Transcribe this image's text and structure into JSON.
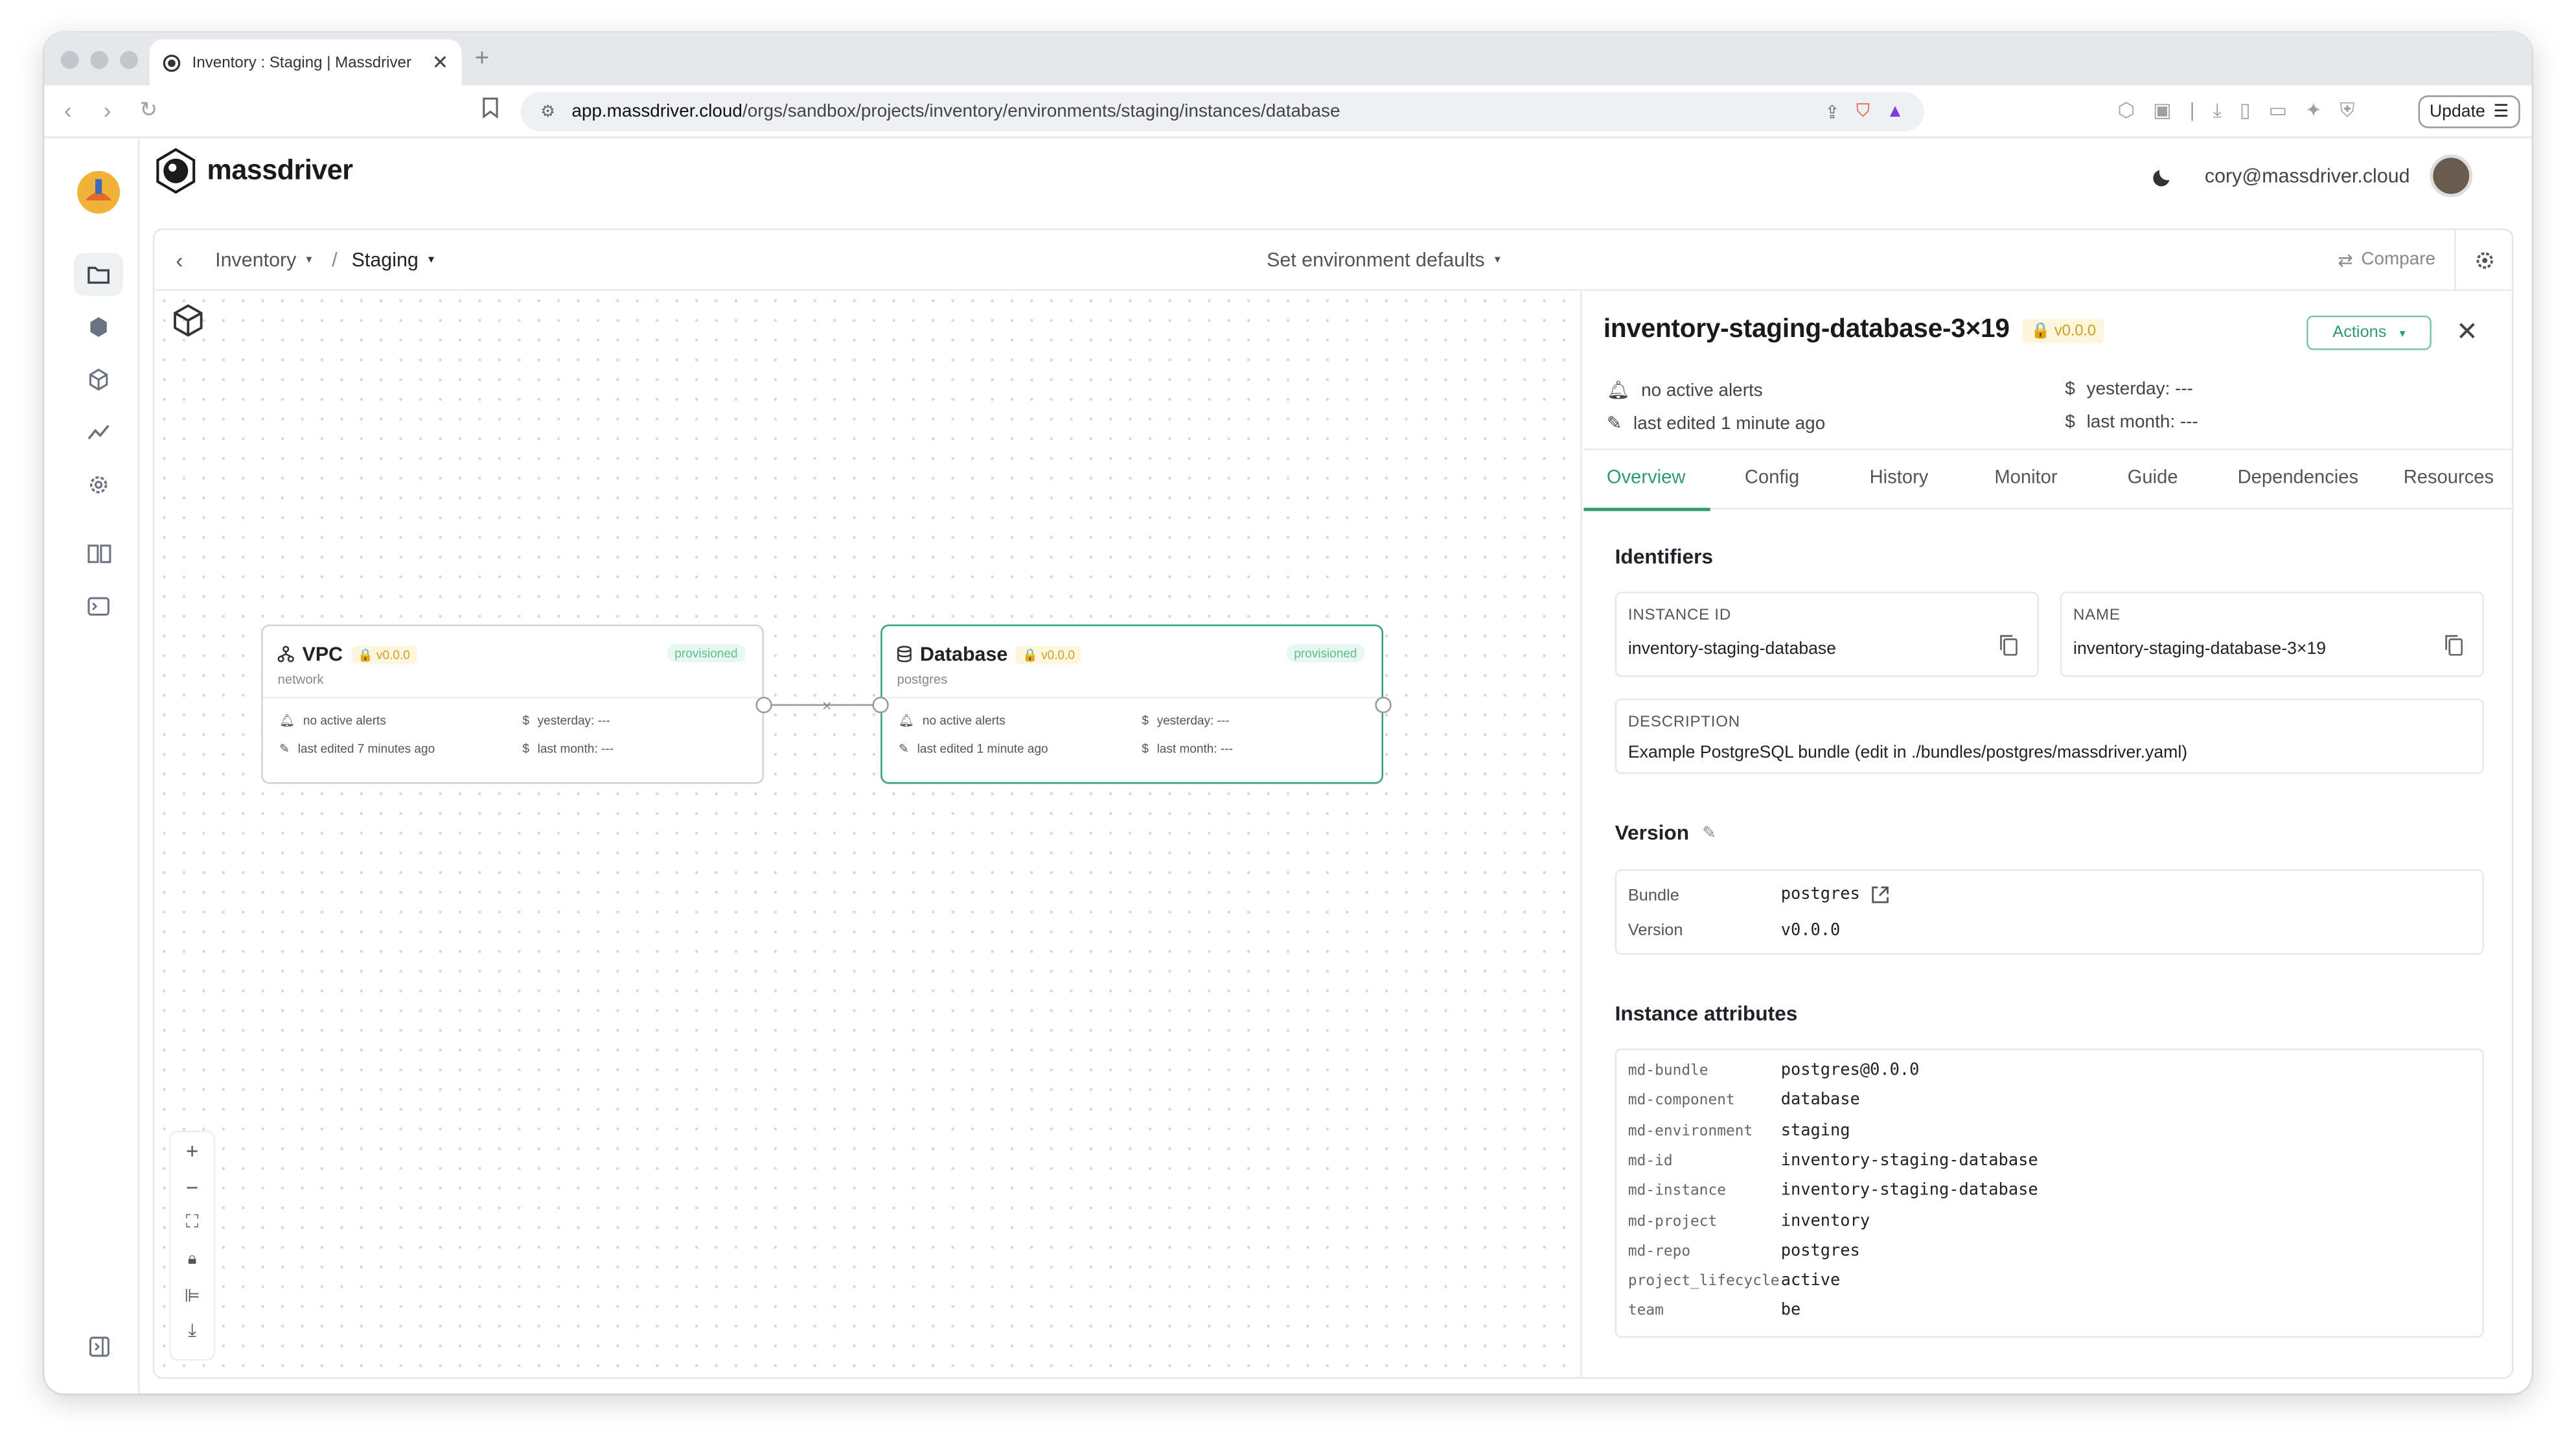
{
  "browser": {
    "tab_title": "Inventory : Staging | Massdriver",
    "url_host": "app.massdriver.cloud",
    "url_path": "/orgs/sandbox/projects/inventory/environments/staging/instances/database",
    "update_label": "Update"
  },
  "app": {
    "logo_text": "massdriver",
    "user_email": "cory@massdriver.cloud"
  },
  "breadcrumb": {
    "project": "Inventory",
    "separator": "/",
    "environment": "Staging"
  },
  "header": {
    "env_defaults": "Set environment defaults",
    "compare": "Compare"
  },
  "nodes": [
    {
      "name": "VPC",
      "version": "v0.0.0",
      "status": "provisioned",
      "type": "network",
      "alerts": "no active alerts",
      "edited": "last edited 7 minutes ago",
      "yesterday": "yesterday: ---",
      "last_month": "last month: ---"
    },
    {
      "name": "Database",
      "version": "v0.0.0",
      "status": "provisioned",
      "type": "postgres",
      "alerts": "no active alerts",
      "edited": "last edited 1 minute ago",
      "yesterday": "yesterday: ---",
      "last_month": "last month: ---"
    }
  ],
  "detail": {
    "title": "inventory-staging-database-3×19",
    "version": "v0.0.0",
    "actions": "Actions",
    "alerts": "no active alerts",
    "edited": "last edited 1 minute ago",
    "yesterday": "yesterday: ---",
    "last_month": "last month: ---",
    "tabs": [
      "Overview",
      "Config",
      "History",
      "Monitor",
      "Guide",
      "Dependencies",
      "Resources"
    ],
    "identifiers_heading": "Identifiers",
    "instance_id_label": "INSTANCE ID",
    "instance_id": "inventory-staging-database",
    "name_label": "NAME",
    "name": "inventory-staging-database-3×19",
    "description_label": "DESCRIPTION",
    "description": "Example PostgreSQL bundle (edit in ./bundles/postgres/massdriver.yaml)",
    "version_heading": "Version",
    "bundle_label": "Bundle",
    "bundle_value": "postgres",
    "version_label": "Version",
    "version_value": "v0.0.0",
    "attributes_heading": "Instance attributes",
    "attributes": [
      {
        "key": "md-bundle",
        "value": "postgres@0.0.0"
      },
      {
        "key": "md-component",
        "value": "database"
      },
      {
        "key": "md-environment",
        "value": "staging"
      },
      {
        "key": "md-id",
        "value": "inventory-staging-database"
      },
      {
        "key": "md-instance",
        "value": "inventory-staging-database"
      },
      {
        "key": "md-project",
        "value": "inventory"
      },
      {
        "key": "md-repo",
        "value": "postgres"
      },
      {
        "key": "project_lifecycle",
        "value": "active"
      },
      {
        "key": "team",
        "value": "be"
      }
    ]
  },
  "colors": {
    "accent": "#2f9b6b",
    "selected_border": "#2fa37a",
    "version_badge": "#c9a227"
  }
}
